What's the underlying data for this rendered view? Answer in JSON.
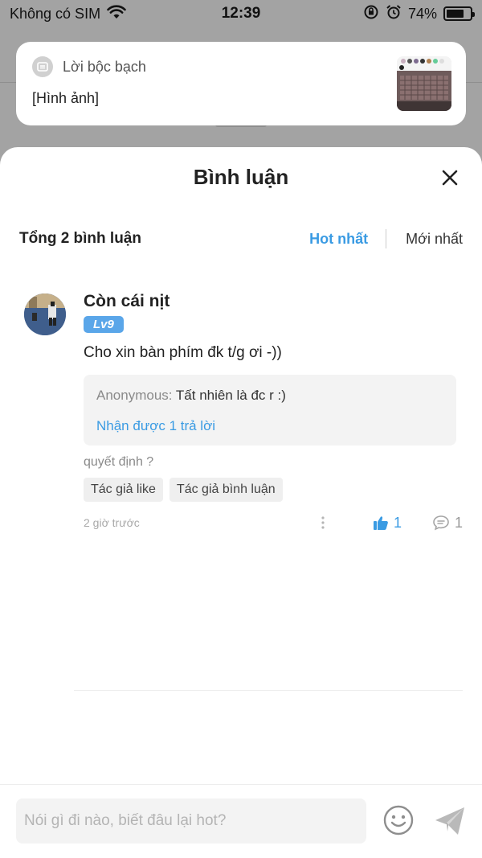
{
  "status_bar": {
    "carrier": "Không có SIM",
    "time": "12:39",
    "battery_percent": "74%",
    "battery_level": 0.74
  },
  "notification": {
    "app_name": "Lời bộc bạch",
    "body": "[Hình ảnh]"
  },
  "sheet": {
    "title": "Bình luận",
    "total_label": "Tổng 2 bình luận",
    "sort_hot": "Hot nhất",
    "sort_new": "Mới nhất"
  },
  "comment": {
    "author": "Còn cái nịt",
    "level": "Lv9",
    "text": "Cho xin bàn phím đk t/g ơi -))",
    "reply": {
      "author": "Anonymous:",
      "text": " Tất nhiên là đc r :)",
      "more": "Nhận được 1 trả lời"
    },
    "question": "quyết định ?",
    "tags": [
      "Tác giả like",
      "Tác giả bình luận"
    ],
    "time": "2 giờ trước",
    "likes": "1",
    "replies": "1"
  },
  "input": {
    "placeholder": "Nói gì đi nào, biết đâu lại hot?"
  },
  "colors": {
    "accent": "#3a9be3",
    "badge": "#5aa6e9"
  }
}
